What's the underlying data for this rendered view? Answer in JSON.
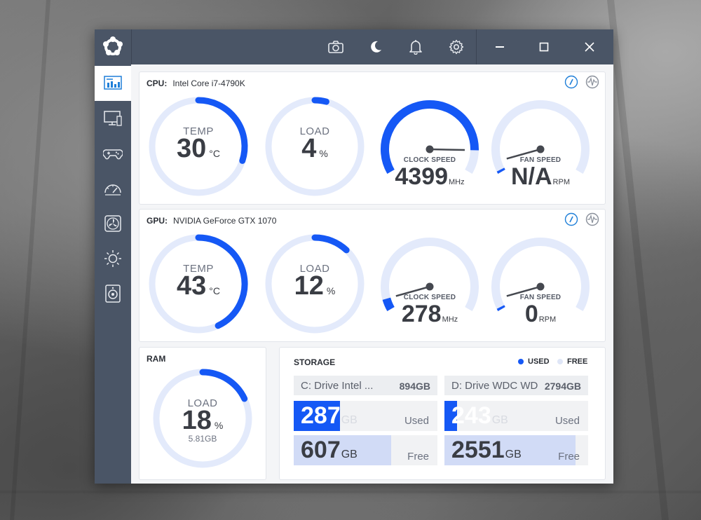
{
  "colors": {
    "accent": "#1558f5",
    "track": "#e3eafb",
    "titlebar": "#4a5566",
    "free_fill": "#d1dbf6"
  },
  "titlebar": {
    "icons": [
      "app-logo-icon",
      "camera-icon",
      "moon-icon",
      "bell-icon",
      "gear-icon",
      "minimize-icon",
      "maximize-icon",
      "close-icon"
    ]
  },
  "sidebar": {
    "items": [
      {
        "name": "dashboard-icon",
        "active": true
      },
      {
        "name": "monitor-icon",
        "active": false
      },
      {
        "name": "gamepad-icon",
        "active": false
      },
      {
        "name": "speedometer-icon",
        "active": false
      },
      {
        "name": "fan-icon",
        "active": false
      },
      {
        "name": "sun-icon",
        "active": false
      },
      {
        "name": "speaker-icon",
        "active": false
      }
    ]
  },
  "cpu": {
    "label": "CPU:",
    "name": "Intel Core i7-4790K",
    "temp": {
      "label": "TEMP",
      "value": "30",
      "unit": "°C",
      "fraction": 0.3
    },
    "load": {
      "label": "LOAD",
      "value": "4",
      "unit": "%",
      "fraction": 0.04
    },
    "clock": {
      "label": "CLOCK SPEED",
      "value": "4399",
      "unit": "MHz",
      "fraction": 0.88
    },
    "fan": {
      "label": "FAN SPEED",
      "value": "N/A",
      "unit": "RPM",
      "fraction": 0.0
    }
  },
  "gpu": {
    "label": "GPU:",
    "name": "NVIDIA GeForce GTX 1070",
    "temp": {
      "label": "TEMP",
      "value": "43",
      "unit": "°C",
      "fraction": 0.43
    },
    "load": {
      "label": "LOAD",
      "value": "12",
      "unit": "%",
      "fraction": 0.12
    },
    "clock": {
      "label": "CLOCK SPEED",
      "value": "278",
      "unit": "MHz",
      "fraction": 0.06
    },
    "fan": {
      "label": "FAN SPEED",
      "value": "0",
      "unit": "RPM",
      "fraction": 0.0
    }
  },
  "ram": {
    "title": "RAM",
    "label": "LOAD",
    "value": "18",
    "unit": "%",
    "sub": "5.81GB",
    "fraction": 0.18
  },
  "storage": {
    "title": "STORAGE",
    "legend_used": "USED",
    "legend_free": "FREE",
    "drives": [
      {
        "name": "C: Drive Intel ...",
        "size": "894GB",
        "used": "287",
        "free": "607",
        "unit": "GB",
        "used_label": "Used",
        "free_label": "Free",
        "used_fraction": 0.32,
        "free_fraction": 0.68
      },
      {
        "name": "D: Drive WDC WD",
        "size": "2794GB",
        "used": "243",
        "free": "2551",
        "unit": "GB",
        "used_label": "Used",
        "free_label": "Free",
        "used_fraction": 0.087,
        "free_fraction": 0.913
      }
    ]
  }
}
